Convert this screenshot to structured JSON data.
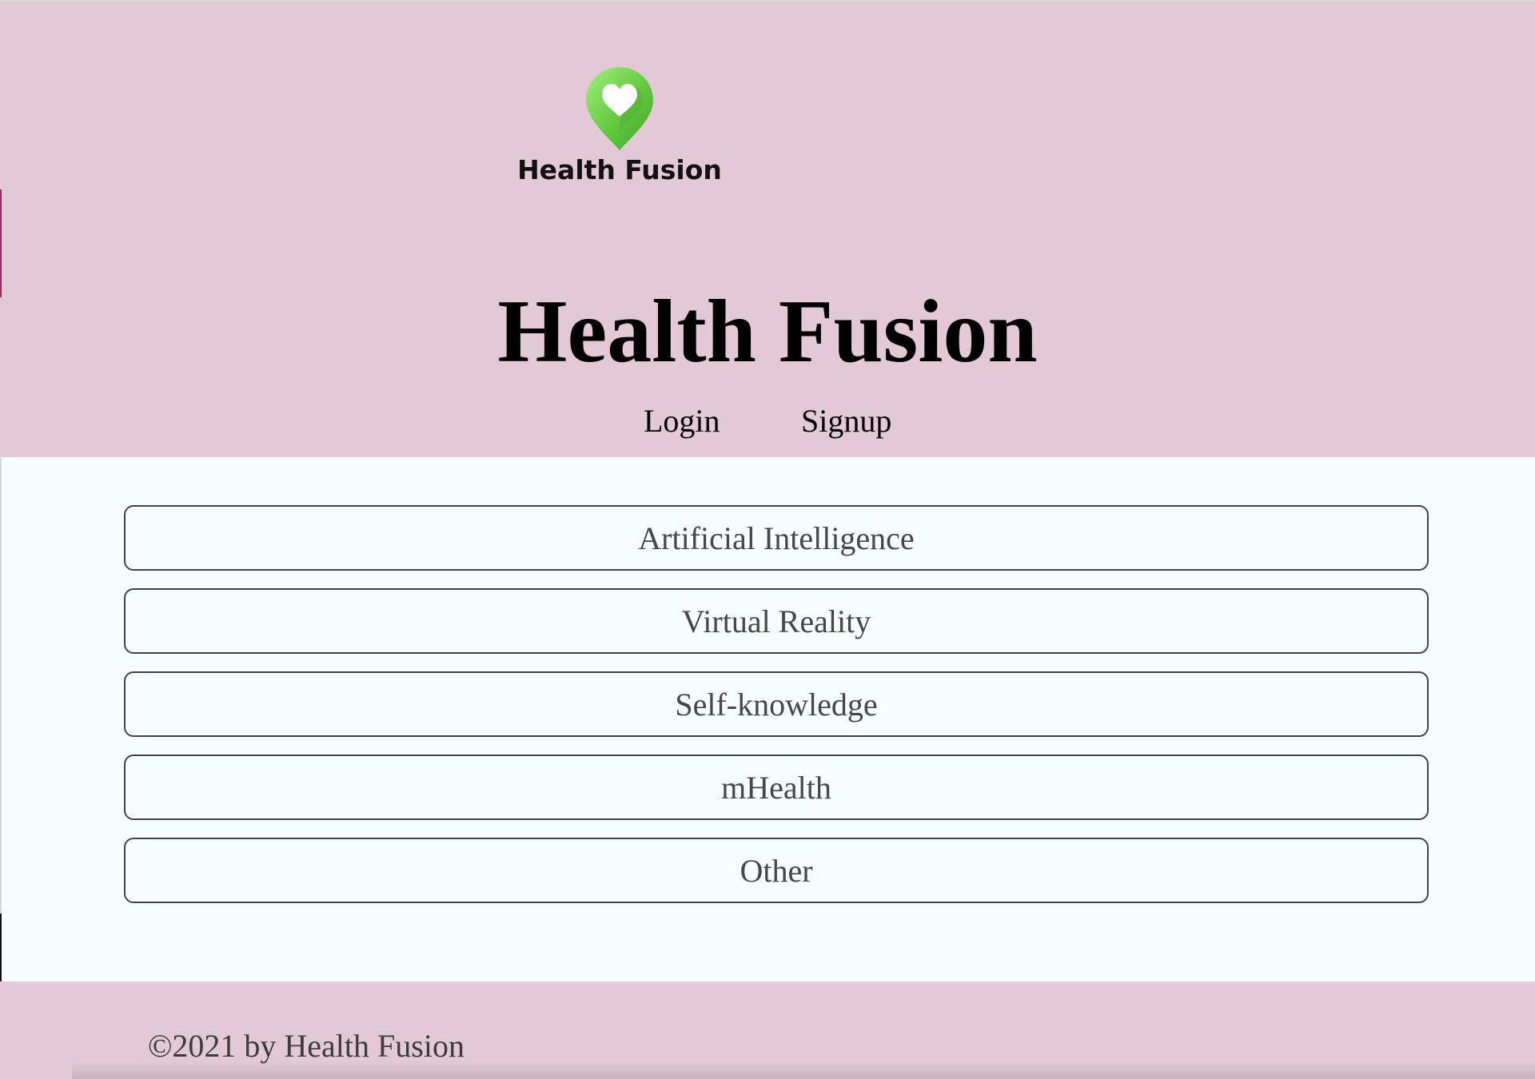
{
  "brand": {
    "logo_icon": "heart-pin-icon",
    "logo_text": "Health Fusion",
    "logo_color": "#62c93f"
  },
  "header": {
    "title": "Health Fusion",
    "nav": {
      "login_label": "Login",
      "signup_label": "Signup"
    }
  },
  "topics": [
    {
      "label": "Artificial Intelligence"
    },
    {
      "label": "Virtual Reality"
    },
    {
      "label": "Self-knowledge"
    },
    {
      "label": "mHealth"
    },
    {
      "label": "Other"
    }
  ],
  "footer": {
    "copyright": "©2021 by Health Fusion"
  },
  "colors": {
    "header_background": "#e3c9d5",
    "content_background": "#f6fefd",
    "button_border": "#444444",
    "button_text": "#474747"
  }
}
